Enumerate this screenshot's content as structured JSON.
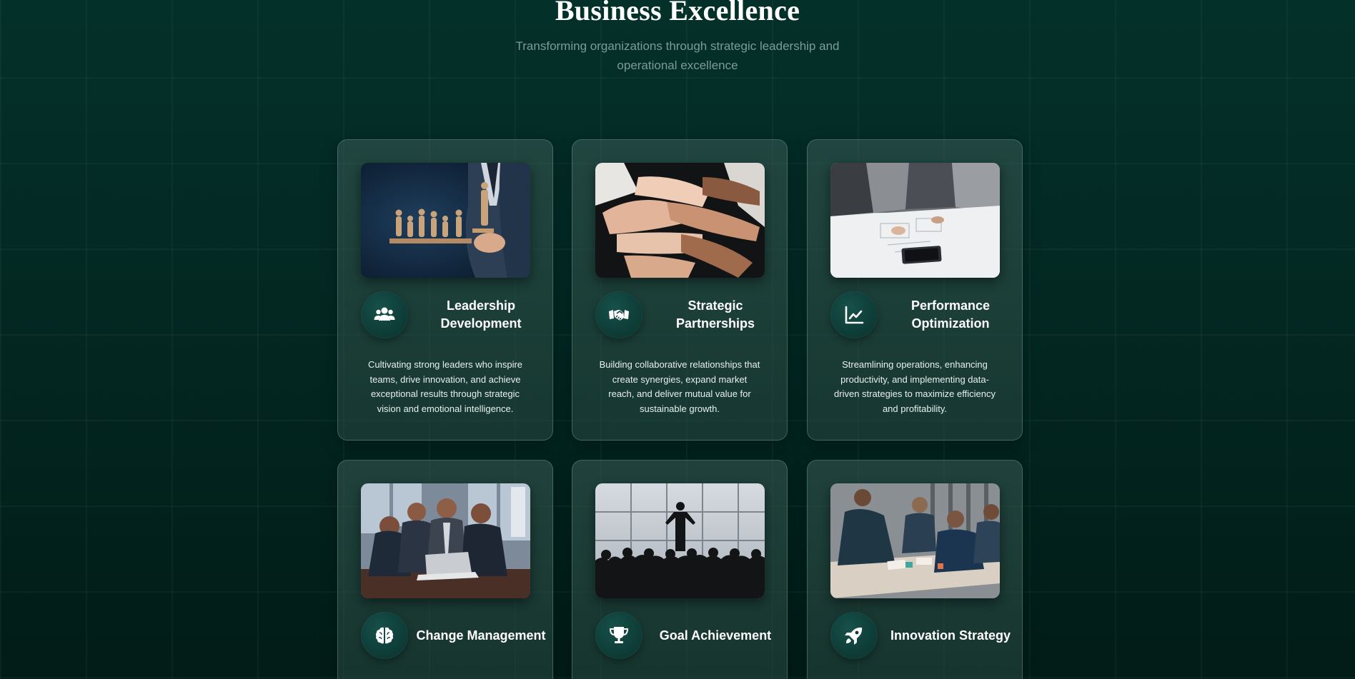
{
  "header": {
    "title": "Business Excellence",
    "subtitle": "Transforming organizations through strategic leadership and operational excellence"
  },
  "cards": [
    {
      "title": "Leadership Development",
      "description": "Cultivating strong leaders who inspire teams, drive innovation, and achieve exceptional results through strategic vision and emotional intelligence.",
      "icon": "users-icon",
      "image": "leadership-figures-photo"
    },
    {
      "title": "Strategic Partnerships",
      "description": "Building collaborative relationships that create synergies, expand market reach, and deliver mutual value for sustainable growth.",
      "icon": "handshake-icon",
      "image": "stacked-hands-photo"
    },
    {
      "title": "Performance Optimization",
      "description": "Streamlining operations, enhancing productivity, and implementing data-driven strategies to maximize efficiency and profitability.",
      "icon": "line-chart-icon",
      "image": "team-planning-table-photo"
    },
    {
      "title": "Change Management",
      "icon": "brain-icon",
      "image": "team-at-laptop-photo"
    },
    {
      "title": "Goal Achievement",
      "icon": "trophy-icon",
      "image": "speaker-silhouette-photo"
    },
    {
      "title": "Innovation Strategy",
      "icon": "rocket-icon",
      "image": "team-collaboration-photo"
    }
  ],
  "colors": {
    "background": "#032822",
    "card_border": "#5c7f77",
    "icon_circle": "#0d3a35",
    "subtitle": "#7e9b95"
  }
}
